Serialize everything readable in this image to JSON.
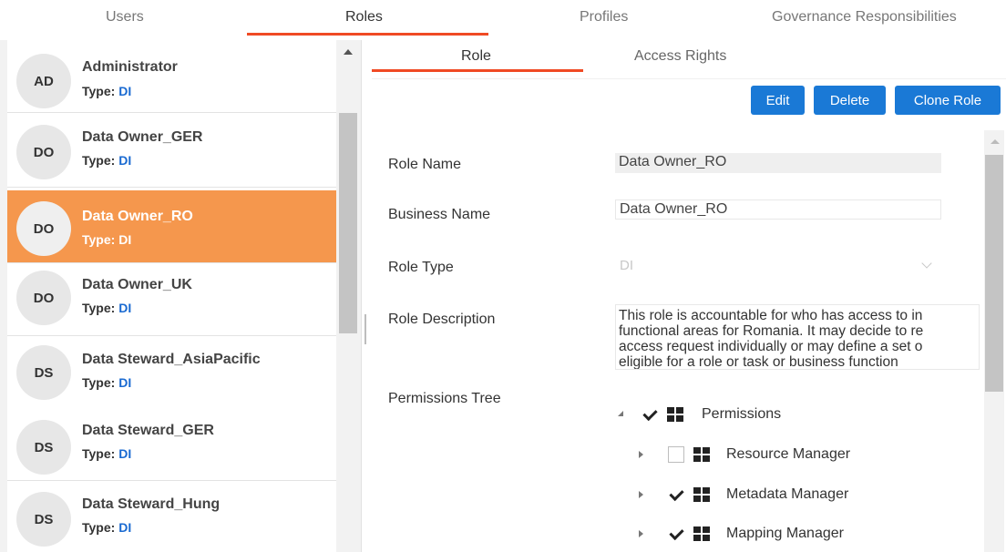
{
  "top_tabs": [
    {
      "label": "Users",
      "active": false
    },
    {
      "label": "Roles",
      "active": true
    },
    {
      "label": "Profiles",
      "active": false
    },
    {
      "label": "Governance Responsibilities",
      "active": false
    }
  ],
  "roles": [
    {
      "initials": "AD",
      "name": "Administrator",
      "type_label": "Type:",
      "type_value": "DI",
      "selected": false
    },
    {
      "initials": "DO",
      "name": "Data Owner_GER",
      "type_label": "Type:",
      "type_value": "DI",
      "selected": false
    },
    {
      "initials": "DO",
      "name": "Data Owner_RO",
      "type_label": "Type:",
      "type_value": "DI",
      "selected": true
    },
    {
      "initials": "DO",
      "name": "Data Owner_UK",
      "type_label": "Type:",
      "type_value": "DI",
      "selected": false
    },
    {
      "initials": "DS",
      "name": "Data Steward_AsiaPacific",
      "type_label": "Type:",
      "type_value": "DI",
      "selected": false
    },
    {
      "initials": "DS",
      "name": "Data Steward_GER",
      "type_label": "Type:",
      "type_value": "DI",
      "selected": false
    },
    {
      "initials": "DS",
      "name": "Data Steward_Hung",
      "type_label": "Type:",
      "type_value": "DI",
      "selected": false
    }
  ],
  "sub_tabs": [
    {
      "label": "Role",
      "active": true
    },
    {
      "label": "Access Rights",
      "active": false
    }
  ],
  "actions": {
    "edit": "Edit",
    "delete": "Delete",
    "clone": "Clone Role"
  },
  "form": {
    "role_name_label": "Role Name",
    "role_name_value": "Data Owner_RO",
    "business_name_label": "Business Name",
    "business_name_value": "Data Owner_RO",
    "role_type_label": "Role Type",
    "role_type_value": "DI",
    "role_description_label": "Role Description",
    "role_description_lines": [
      "This role is accountable for who has access to in",
      "functional areas for Romania. It may decide to re",
      "access request individually or may define a set o",
      "eligible for a role or task or business function"
    ],
    "permissions_tree_label": "Permissions Tree"
  },
  "permissions": [
    {
      "label": "Permissions",
      "checked": true,
      "expanded": true,
      "level": 0
    },
    {
      "label": "Resource Manager",
      "checked": false,
      "expanded": false,
      "level": 1
    },
    {
      "label": "Metadata Manager",
      "checked": true,
      "expanded": false,
      "level": 1
    },
    {
      "label": "Mapping Manager",
      "checked": true,
      "expanded": false,
      "level": 1
    }
  ],
  "colors": {
    "accent": "#f04a24",
    "selected_row": "#f5974d",
    "button": "#1a79d6",
    "type_value": "#1a6ad1"
  }
}
